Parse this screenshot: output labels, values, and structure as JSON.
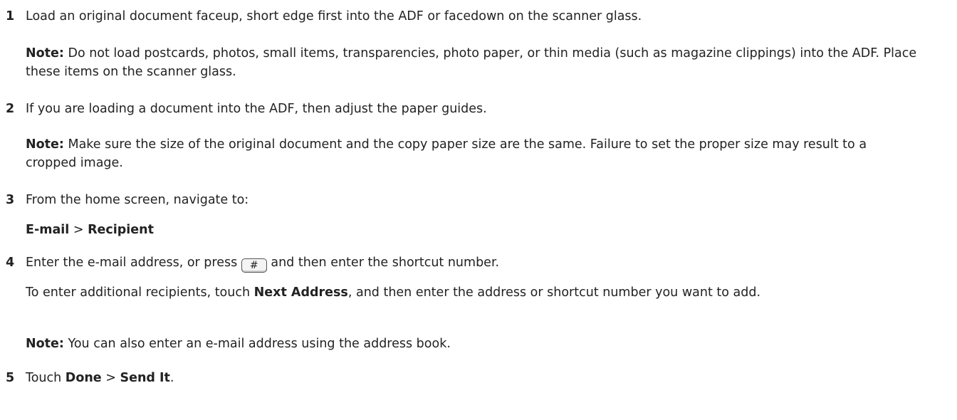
{
  "steps": [
    {
      "number": "1",
      "text": "Load an original document faceup, short edge first into the ADF or facedown on the scanner glass.",
      "note_label": "Note:",
      "note_text": " Do not load postcards, photos, small items, transparencies, photo paper, or thin media (such as magazine clippings) into the ADF. Place these items on the scanner glass."
    },
    {
      "number": "2",
      "text": "If you are loading a document into the ADF, then adjust the paper guides.",
      "note_label": "Note:",
      "note_text": " Make sure the size of the original document and the copy paper size are the same. Failure to set the proper size may result to a cropped image."
    },
    {
      "number": "3",
      "text": "From the home screen, navigate to:",
      "path_first": "E-mail",
      "path_sep": " > ",
      "path_second": "Recipient"
    },
    {
      "number": "4",
      "text_before": "Enter the e-mail address, or press ",
      "key_symbol": "#",
      "text_after": " and then enter the shortcut number.",
      "extra_before": "To enter additional recipients, touch ",
      "extra_bold": "Next Address",
      "extra_after": ", and then enter the address or shortcut number you want to add.",
      "note_label": "Note:",
      "note_text": " You can also enter an e-mail address using the address book."
    },
    {
      "number": "5",
      "text_before": "Touch ",
      "bold_first": "Done",
      "sep": " > ",
      "bold_second": "Send It",
      "text_after": "."
    }
  ]
}
